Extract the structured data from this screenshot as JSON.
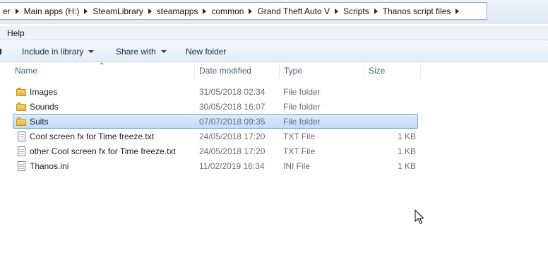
{
  "address_bar": {
    "crumbs": [
      "er",
      "Main apps (H:)",
      "SteamLibrary",
      "steamapps",
      "common",
      "Grand Theft Auto V",
      "Scripts",
      "Thanos script files"
    ]
  },
  "menu": {
    "help_label": "Help"
  },
  "toolbar": {
    "include_in_library_label": "Include in library",
    "share_with_label": "Share with",
    "new_folder_label": "New folder"
  },
  "columns": {
    "name": "Name",
    "date_modified": "Date modified",
    "type": "Type",
    "size": "Size"
  },
  "files": [
    {
      "name": "Images",
      "date": "31/05/2018 02:34",
      "type": "File folder",
      "size": "",
      "icon": "folder-icon",
      "selected": false
    },
    {
      "name": "Sounds",
      "date": "30/05/2018 16:07",
      "type": "File folder",
      "size": "",
      "icon": "folder-icon",
      "selected": false
    },
    {
      "name": "Suits",
      "date": "07/07/2018 09:35",
      "type": "File folder",
      "size": "",
      "icon": "folder-icon",
      "selected": true
    },
    {
      "name": "Cool screen fx for Time freeze.txt",
      "date": "24/05/2018 17:20",
      "type": "TXT File",
      "size": "1 KB",
      "icon": "text-file-icon",
      "selected": false
    },
    {
      "name": "other Cool screen fx for Time freeze.txt",
      "date": "24/05/2018 17:20",
      "type": "TXT File",
      "size": "1 KB",
      "icon": "text-file-icon",
      "selected": false
    },
    {
      "name": "Thanos.ini",
      "date": "11/02/2019 16:34",
      "type": "INI File",
      "size": "1 KB",
      "icon": "text-file-icon",
      "selected": false
    }
  ],
  "colors": {
    "selection_fill": "#cce4fc",
    "selection_border": "#7da2ce",
    "folder_yellow": "#f2c94c"
  }
}
